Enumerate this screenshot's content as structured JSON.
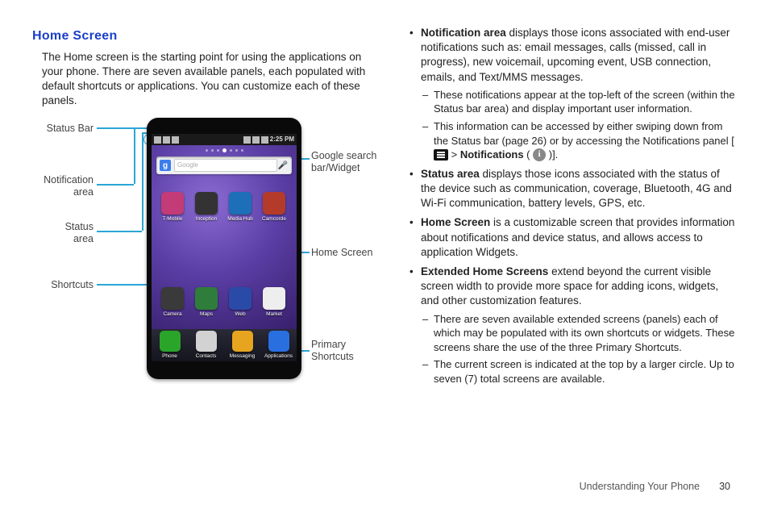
{
  "heading": "Home Screen",
  "intro": "The Home screen is the starting point for using the applications on your phone. There are seven available panels, each populated with default shortcuts or applications. You can customize each of these panels.",
  "labels": {
    "statusBar": "Status Bar",
    "notificationArea": "Notification\narea",
    "statusArea": "Status\narea",
    "shortcuts": "Shortcuts",
    "googleSearch": "Google search\nbar/Widget",
    "homeScreen": "Home Screen",
    "primaryShortcuts": "Primary\nShortcuts"
  },
  "phone": {
    "time": "2:25 PM",
    "searchLogo": "g",
    "searchPlaceholder": "Google",
    "row1": [
      {
        "name": "T-Mobile",
        "color": "#c33b77"
      },
      {
        "name": "Inception",
        "color": "#333"
      },
      {
        "name": "Media Hub",
        "color": "#1d6fb8"
      },
      {
        "name": "Camcorde",
        "color": "#b43a2a"
      }
    ],
    "row2": [
      {
        "name": "Camera",
        "color": "#3a3a3a"
      },
      {
        "name": "Maps",
        "color": "#2f7d3a"
      },
      {
        "name": "Web",
        "color": "#2a4aa8"
      },
      {
        "name": "Market",
        "color": "#eee"
      }
    ],
    "dock": [
      {
        "name": "Phone",
        "color": "#2aa52a"
      },
      {
        "name": "Contacts",
        "color": "#d2d2d2"
      },
      {
        "name": "Messaging",
        "color": "#e6a41f"
      },
      {
        "name": "Applications",
        "color": "#2a6fe0"
      }
    ]
  },
  "bullets": {
    "b1_lead": "Notification area",
    "b1_rest": " displays those icons associated with end-user notifications such as: email messages, calls (missed, call in progress), new voicemail, upcoming event, USB connection, emails, and Text/MMS messages.",
    "b1_s1": "These notifications appear at the top-left of the screen (within the Status bar area) and display important user information.",
    "b1_s2a": "This information can be accessed by either swiping down from the Status bar (page 26) or by accessing the Notifications panel [",
    "b1_s2b": " > ",
    "b1_s2c": "Notifications",
    "b1_s2d": " ( ",
    "b1_s2e": " )].",
    "b2_lead": "Status area",
    "b2_rest": " displays those icons associated with the status of the device such as communication, coverage, Bluetooth, 4G and Wi-Fi communication, battery levels, GPS, etc.",
    "b3_lead": "Home Screen",
    "b3_rest": " is a customizable screen that provides information about notifications and device status, and allows access to application Widgets.",
    "b4_lead": "Extended Home Screens",
    "b4_rest": " extend beyond the current visible screen width to provide more space for adding icons, widgets, and other customization features.",
    "b4_s1": "There are seven available extended screens (panels) each of which may be populated with its own shortcuts or widgets. These screens share the use of the three Primary Shortcuts.",
    "b4_s2": "The current screen is indicated at the top by a larger circle. Up to seven (7) total screens are available."
  },
  "footer": {
    "section": "Understanding Your Phone",
    "page": "30"
  }
}
